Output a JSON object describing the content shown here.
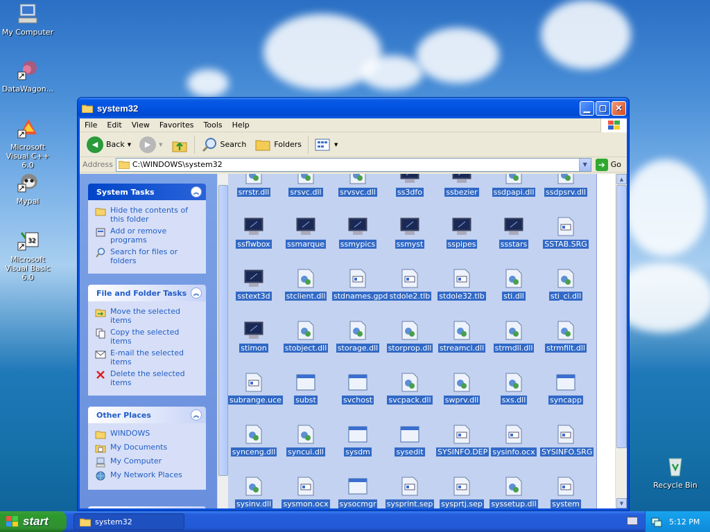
{
  "desktop": {
    "icons": [
      {
        "label": "My Computer",
        "icon": "computer-icon"
      },
      {
        "label": "DataWagon...",
        "icon": "shortcut-icon"
      },
      {
        "label": "Microsoft Visual C++ 6.0",
        "icon": "visual-cpp-icon"
      },
      {
        "label": "Mypal",
        "icon": "mypal-icon"
      },
      {
        "label": "Microsoft Visual Basic 6.0",
        "icon": "visual-basic-icon"
      },
      {
        "label": "Recycle Bin",
        "icon": "recycle-bin-icon"
      }
    ]
  },
  "window": {
    "title": "system32",
    "menu": [
      "File",
      "Edit",
      "View",
      "Favorites",
      "Tools",
      "Help"
    ],
    "toolbar": {
      "back": "Back",
      "search": "Search",
      "folders": "Folders"
    },
    "address": {
      "label": "Address",
      "value": "C:\\WINDOWS\\system32",
      "go": "Go"
    },
    "panels": {
      "system_tasks": {
        "title": "System Tasks",
        "items": [
          "Hide the contents of this folder",
          "Add or remove programs",
          "Search for files or folders"
        ]
      },
      "file_tasks": {
        "title": "File and Folder Tasks",
        "items": [
          "Move the selected items",
          "Copy the selected items",
          "E-mail the selected items",
          "Delete the selected items"
        ]
      },
      "other_places": {
        "title": "Other Places",
        "items": [
          "WINDOWS",
          "My Documents",
          "My Computer",
          "My Network Places"
        ]
      }
    },
    "files": [
      [
        "srrstr.dll",
        "srsvc.dll",
        "srvsvc.dll",
        "ss3dfo",
        "ssbezier",
        "ssdpapi.dll",
        "ssdpsrv.dll"
      ],
      [
        "ssflwbox",
        "ssmarque",
        "ssmypics",
        "ssmyst",
        "sspipes",
        "ssstars",
        "SSTAB.SRG"
      ],
      [
        "sstext3d",
        "stclient.dll",
        "stdnames.gpd",
        "stdole2.tlb",
        "stdole32.tlb",
        "sti.dll",
        "sti_ci.dll"
      ],
      [
        "stimon",
        "stobject.dll",
        "storage.dll",
        "storprop.dll",
        "streamci.dll",
        "strmdll.dll",
        "strmfilt.dll"
      ],
      [
        "subrange.uce",
        "subst",
        "svchost",
        "svcpack.dll",
        "swprv.dll",
        "sxs.dll",
        "syncapp"
      ],
      [
        "synceng.dll",
        "syncui.dll",
        "sysdm",
        "sysedit",
        "SYSINFO.DEP",
        "sysinfo.ocx",
        "SYSINFO.SRG"
      ],
      [
        "sysinv.dll",
        "sysmon.ocx",
        "sysocmgr",
        "sysprint.sep",
        "sysprtj.sep",
        "syssetup.dll",
        "system"
      ]
    ]
  },
  "taskbar": {
    "start": "start",
    "task": "system32",
    "clock": "5:12 PM"
  }
}
